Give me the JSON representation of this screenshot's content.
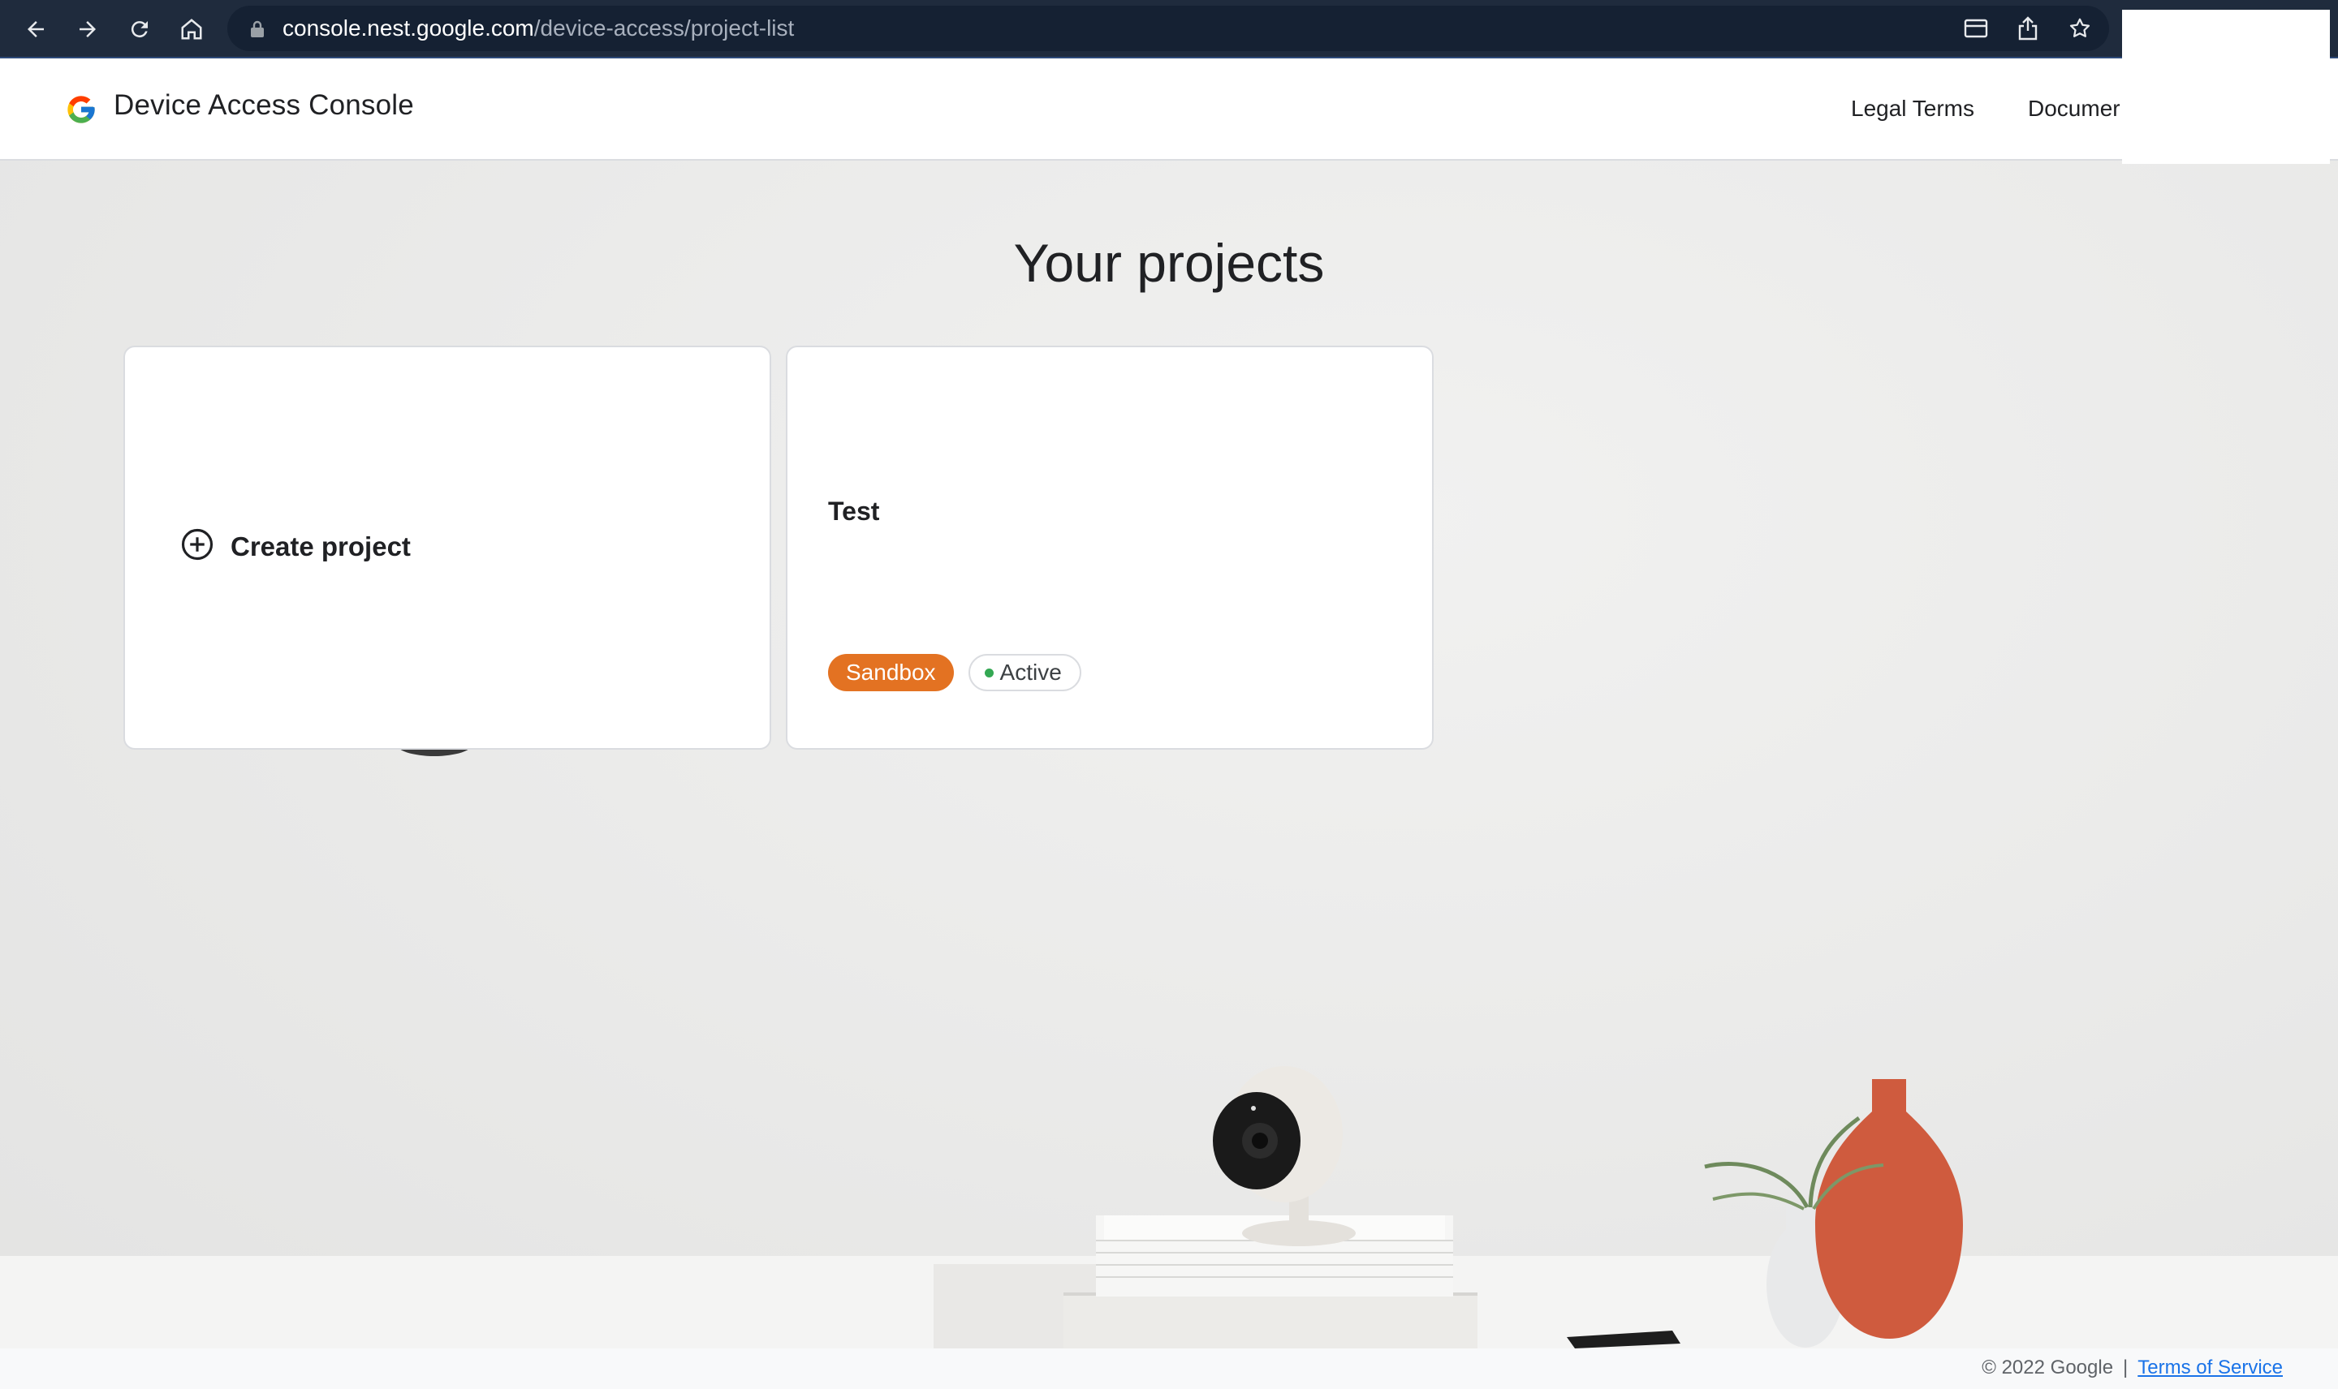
{
  "browser": {
    "url_host": "console.nest.google.com",
    "url_path": "/device-access/project-list",
    "icons": [
      "back-icon",
      "forward-icon",
      "reload-icon",
      "home-icon",
      "lock-icon",
      "reader-mode-icon",
      "share-icon",
      "bookmark-star-icon"
    ]
  },
  "header": {
    "app_title": "Device Access Console",
    "nav": {
      "legal_terms": "Legal Terms",
      "documentation": "Documer"
    }
  },
  "main": {
    "page_title": "Your projects",
    "create_card": {
      "label": "Create project",
      "icon": "add-circle-icon"
    },
    "projects": [
      {
        "name": "Test",
        "environment": "Sandbox",
        "status": "Active"
      }
    ]
  },
  "footer": {
    "copyright": "© 2022 Google",
    "separator": "|",
    "terms_link": "Terms of Service"
  },
  "colors": {
    "chrome_bg": "#1f2b3d",
    "sandbox_chip": "#e37222",
    "active_dot": "#34a853",
    "link": "#1a73e8"
  }
}
